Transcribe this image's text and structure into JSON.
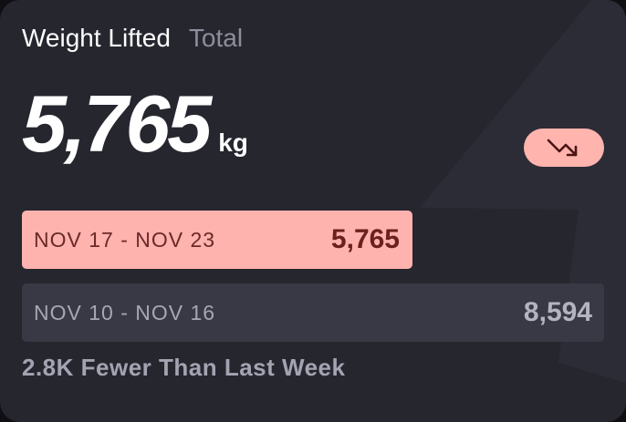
{
  "header": {
    "title": "Weight Lifted",
    "subtitle": "Total"
  },
  "summary": {
    "value": "5,765",
    "unit": "kg",
    "trend_icon": "trending-down-icon"
  },
  "weeks": [
    {
      "range": "NOV 17 - NOV 23",
      "value": "5,765"
    },
    {
      "range": "NOV 10 - NOV 16",
      "value": "8,594"
    }
  ],
  "footer": {
    "comparison": "2.8K Fewer Than Last Week"
  },
  "colors": {
    "card_background": "#26262f",
    "accent_pink": "#ffb3ae",
    "accent_dark_red": "#6b1f1e",
    "muted_bar": "#393945",
    "muted_text": "#a4a3b2"
  }
}
